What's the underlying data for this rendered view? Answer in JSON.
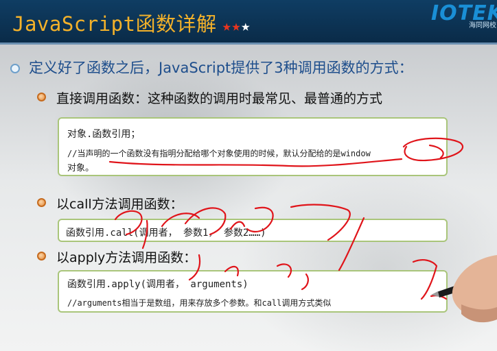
{
  "header": {
    "title": "JavaScript函数详解",
    "stars_on": "★★",
    "stars_off": "★",
    "logo_text": "IOTEK",
    "logo_sub": "海同网校"
  },
  "main": {
    "intro": "定义好了函数之后，JavaScript提供了3种调用函数的方式：",
    "items": [
      {
        "label": "直接调用函数：这种函数的调用时最常见、最普通的方式",
        "code": [
          "对象.函数引用；",
          "//当声明的一个函数没有指明分配给哪个对象使用的时候，默认分配给的是window",
          "对象。"
        ]
      },
      {
        "label": "以call方法调用函数：",
        "code": [
          "函数引用.call(调用者， 参数1， 参数2……)"
        ]
      },
      {
        "label": "以apply方法调用函数：",
        "code": [
          "函数引用.apply(调用者， arguments)",
          "//arguments相当于是数组，用来存放多个参数。和call调用方式类似"
        ]
      }
    ]
  },
  "colors": {
    "header_bg": "#0f3d63",
    "title": "#f3b12a",
    "intro_text": "#1e4e8c",
    "box_border": "#a9c57a",
    "annotation": "#e0141a"
  }
}
